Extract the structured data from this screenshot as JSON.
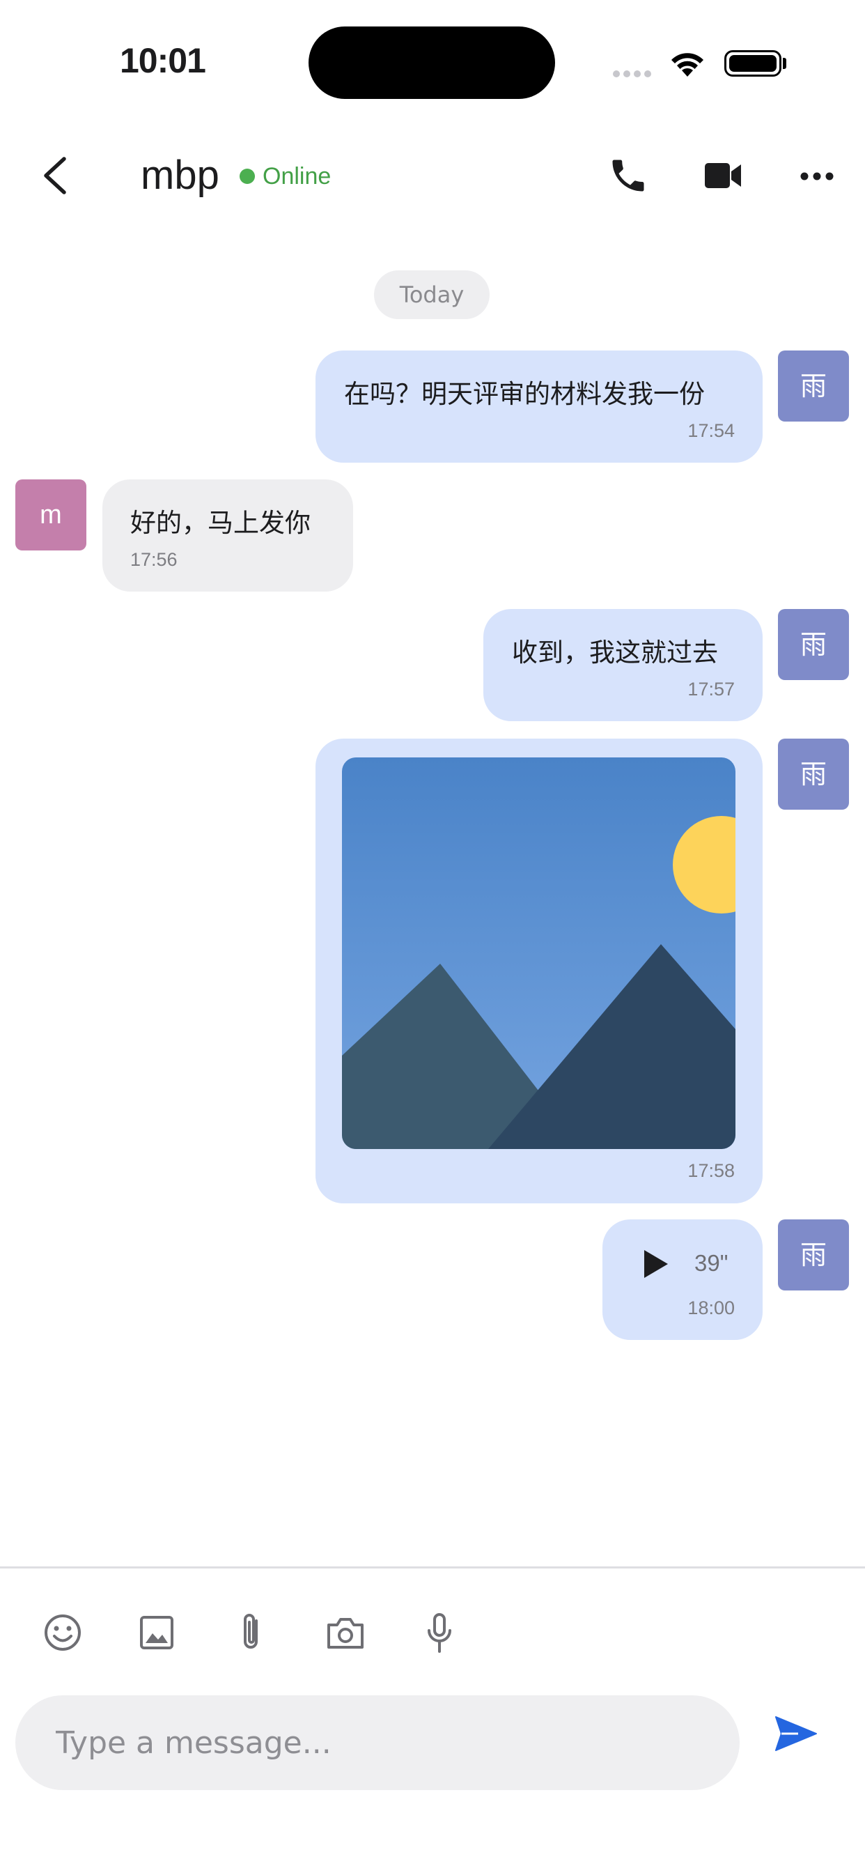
{
  "status_bar": {
    "time": "10:01"
  },
  "header": {
    "contact_name": "mbp",
    "presence": "Online",
    "presence_color": "#4caf50",
    "icons": [
      "back-chevron-icon",
      "phone-icon",
      "video-camera-icon",
      "more-icon"
    ]
  },
  "chat": {
    "date_label": "Today",
    "messages": [
      {
        "sender": "me",
        "avatar": "雨",
        "type": "text",
        "text": "在吗？明天评审的材料发我一份",
        "time": "17:54"
      },
      {
        "sender": "them",
        "avatar": "m",
        "type": "text",
        "text": "好的，马上发你",
        "time": "17:56"
      },
      {
        "sender": "me",
        "avatar": "雨",
        "type": "text",
        "text": "收到，我这就过去",
        "time": "17:57"
      },
      {
        "sender": "me",
        "avatar": "雨",
        "type": "image",
        "time": "17:58"
      },
      {
        "sender": "me",
        "avatar": "雨",
        "type": "voice",
        "duration": "39\"",
        "time": "18:00"
      }
    ]
  },
  "toolbar": {
    "icons": [
      "emoji-icon",
      "image-icon",
      "attachment-icon",
      "camera-icon",
      "microphone-icon"
    ]
  },
  "composer": {
    "placeholder": "Type a message...",
    "send_color": "#2466e0"
  },
  "colors": {
    "my_bubble": "#d7e3fc",
    "their_bubble": "#eeeef0",
    "my_avatar": "#7f8bc9",
    "their_avatar": "#c47fab"
  }
}
